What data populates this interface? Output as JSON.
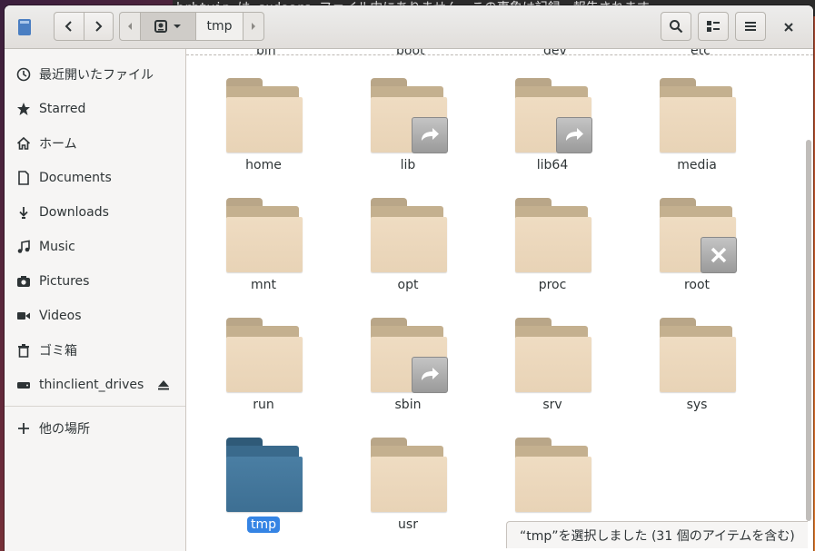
{
  "terminal": {
    "text": "hrbtvin は sudoers ファイル内にありません。この事象は記録・報告されます。"
  },
  "header": {
    "path_current": "tmp",
    "icons": {
      "app": "files-app-icon",
      "back": "back-icon",
      "forward": "forward-icon",
      "root": "drive-icon",
      "search": "search-icon",
      "view": "view-options-icon",
      "menu": "hamburger-menu-icon",
      "close": "close-icon"
    }
  },
  "sidebar": {
    "items": [
      {
        "label": "最近開いたファイル",
        "icon": "recent-icon"
      },
      {
        "label": "Starred",
        "icon": "star-icon"
      },
      {
        "label": "ホーム",
        "icon": "home-icon"
      },
      {
        "label": "Documents",
        "icon": "document-icon"
      },
      {
        "label": "Downloads",
        "icon": "download-icon"
      },
      {
        "label": "Music",
        "icon": "music-icon"
      },
      {
        "label": "Pictures",
        "icon": "camera-icon"
      },
      {
        "label": "Videos",
        "icon": "video-icon"
      },
      {
        "label": "ゴミ箱",
        "icon": "trash-icon"
      },
      {
        "label": "thinclient_drives",
        "icon": "drive-icon"
      },
      {
        "label": "他の場所",
        "icon": "plus-icon"
      }
    ]
  },
  "content": {
    "clipped_row": [
      "bin",
      "boot",
      "dev",
      "etc"
    ],
    "items": [
      {
        "name": "home",
        "emblem": ""
      },
      {
        "name": "lib",
        "emblem": "symlink"
      },
      {
        "name": "lib64",
        "emblem": "symlink"
      },
      {
        "name": "media",
        "emblem": ""
      },
      {
        "name": "mnt",
        "emblem": ""
      },
      {
        "name": "opt",
        "emblem": ""
      },
      {
        "name": "proc",
        "emblem": ""
      },
      {
        "name": "root",
        "emblem": "no-access"
      },
      {
        "name": "run",
        "emblem": ""
      },
      {
        "name": "sbin",
        "emblem": "symlink"
      },
      {
        "name": "srv",
        "emblem": ""
      },
      {
        "name": "sys",
        "emblem": ""
      },
      {
        "name": "tmp",
        "emblem": "",
        "selected": true
      },
      {
        "name": "usr",
        "emblem": ""
      },
      {
        "name": "",
        "emblem": ""
      }
    ]
  },
  "status": {
    "text": "“tmp”を選択しました (31 個のアイテムを含む)"
  },
  "colors": {
    "selection": "#3584e4",
    "folder": "#e8d3b6",
    "folder_selected": "#3d6f93"
  }
}
